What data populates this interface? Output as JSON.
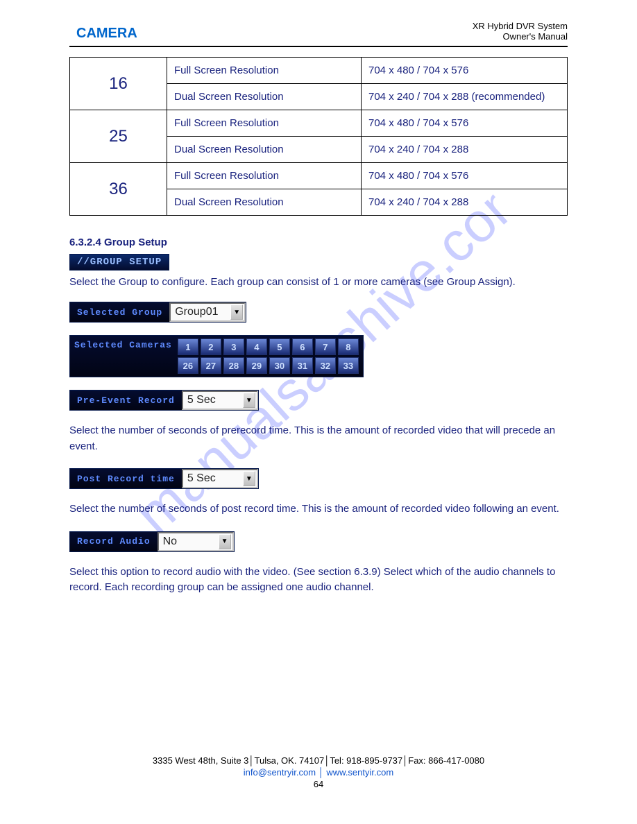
{
  "watermark": "manualsarchive.com",
  "header": {
    "title": "CAMERA",
    "doc": "XR Hybrid DVR System",
    "owner": "Owner's Manual"
  },
  "table": {
    "rows": [
      {
        "a": "16",
        "b1": "Full Screen Resolution",
        "c1": "704 x 480 / 704 x 576",
        "b2": "Dual Screen Resolution",
        "c2": "704 x 240 / 704 x 288 (recommended)",
        "rowspan_a": 2
      },
      {
        "a": "25",
        "b1": "Full Screen Resolution",
        "c1": "704 x 480 / 704 x 576",
        "b2": "Dual Screen Resolution",
        "c2": "704 x 240 / 704 x 288",
        "rowspan_a": 2
      },
      {
        "a": "36",
        "b1": "Full Screen Resolution",
        "c1": "704 x 480 / 704 x 576",
        "b2": "Dual Screen Resolution",
        "c2": "704 x 240 / 704 x 288",
        "rowspan_a": 2
      }
    ]
  },
  "section_title": "6.3.2.4 Group Setup",
  "group_banner": "//GROUP SETUP",
  "group_desc": "Select the Group to configure. Each group can consist of 1 or more cameras (see Group Assign).",
  "selected_group": {
    "label": "Selected Group",
    "value": "Group01"
  },
  "selected_cameras": {
    "label": "Selected Cameras",
    "row1": [
      "1",
      "2",
      "3",
      "4",
      "5",
      "6",
      "7",
      "8"
    ],
    "row2": [
      "26",
      "27",
      "28",
      "29",
      "30",
      "31",
      "32",
      "33"
    ]
  },
  "pre_event": {
    "label": "Pre-Event Record",
    "value": "5 Sec",
    "after": "Select the number of seconds of prerecord time. This is the amount of recorded video that will precede an event."
  },
  "post_record": {
    "label": "Post Record time",
    "value": "5 Sec",
    "after": "Select the number of seconds of post record time. This is the amount of recorded video following an event."
  },
  "record_audio": {
    "label": "Record Audio",
    "value": "No",
    "after": "Select this option to record audio with the video. (See section 6.3.9) Select which of the audio channels to record. Each recording group can be assigned one audio channel."
  },
  "footer": {
    "contact": "3335 West 48th, Suite 3│Tulsa, OK. 74107│Tel: 918-895-9737│Fax: 866-417-0080",
    "links": "info@sentryir.com │ www.sentyir.com",
    "page": "64"
  }
}
